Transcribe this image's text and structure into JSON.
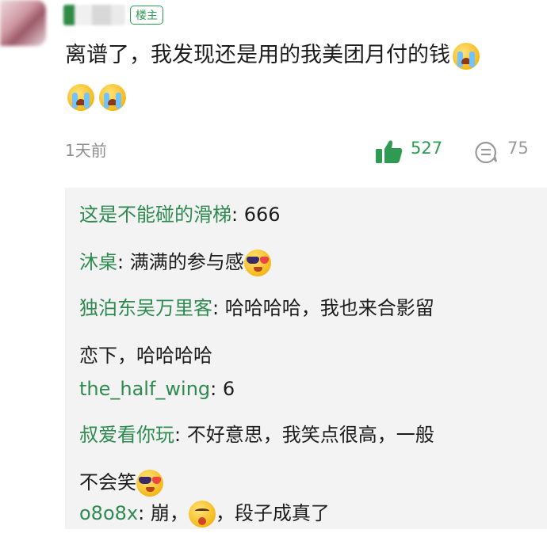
{
  "post": {
    "op_badge": "楼主",
    "text_before_emoji": "离谱了，我发现还是用的我美团月付的钱",
    "emojis": [
      "crying-laughing",
      "crying-laughing",
      "crying-laughing"
    ],
    "time": "1天前",
    "likes": "527",
    "comments": "75"
  },
  "replies": [
    {
      "name": "这是不能碰的滑梯",
      "sep": ": ",
      "text": "666"
    },
    {
      "name": "沐桌",
      "sep": ": ",
      "text": "满满的参与感"
    },
    {
      "name": "独泊东吴万里客",
      "sep": ": ",
      "text_line1": "哈哈哈哈，我也来合影留",
      "text_line2": "恋下，哈哈哈哈"
    },
    {
      "name": "the_half_wing",
      "sep": ": ",
      "text": "6"
    },
    {
      "name": "叔爱看你玩",
      "sep": ": ",
      "text_line1": "不好意思，我笑点很高，一般",
      "text_line2": "不会笑"
    },
    {
      "name": "o8o8x",
      "sep": ": ",
      "text_a": "崩，",
      "text_b": "，段子成真了"
    }
  ],
  "colors": {
    "accent_green": "#2f9a52",
    "reply_name": "#2e8b50",
    "reply_bg": "#f3f3f3",
    "muted": "#8e8e8e"
  }
}
